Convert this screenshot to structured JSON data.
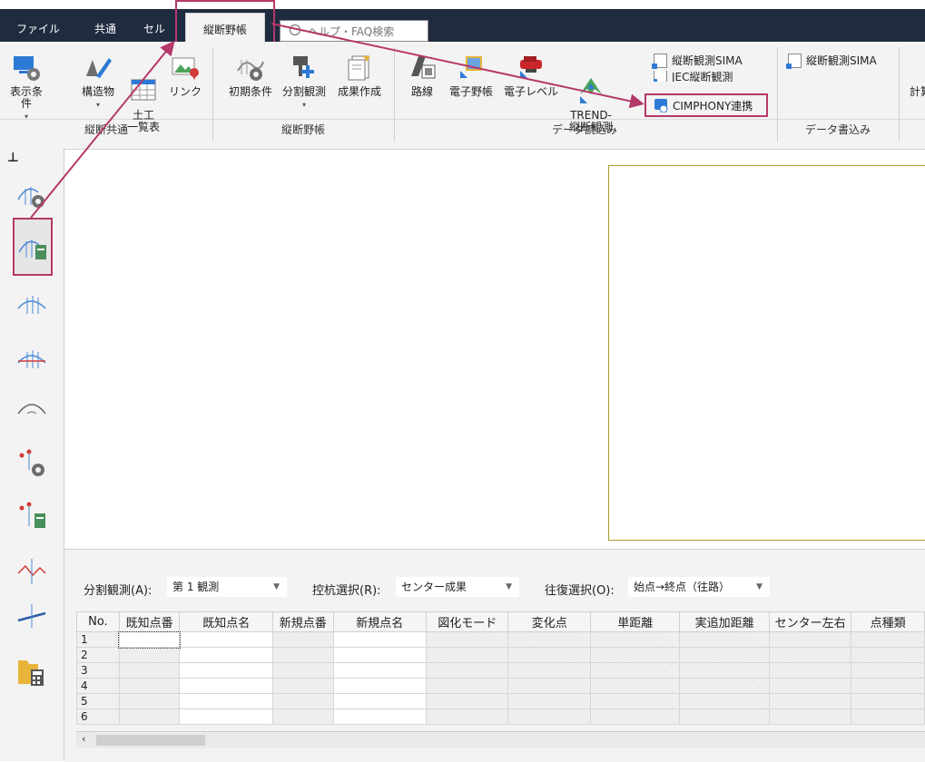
{
  "tabs": [
    "ファイル",
    "共通",
    "セル",
    "縦断野帳"
  ],
  "search_placeholder": "ヘルプ・FAQ検索",
  "ribbon": {
    "group1": {
      "label": "縦断共通",
      "buttons": [
        "表示条件",
        "構造物",
        "土工\n一覧表",
        "リンク"
      ]
    },
    "group2": {
      "label": "縦断野帳",
      "buttons": [
        "初期条件",
        "分割観測",
        "成果作成"
      ]
    },
    "group3": {
      "label": "データ読込み",
      "buttons": [
        "路線",
        "電子野帳",
        "電子レベル",
        "TREND-\n縦断観測"
      ],
      "small": [
        "縦断観測SIMA",
        "JEC縦断観測",
        "CIMPHONY連携"
      ]
    },
    "group4": {
      "label": "データ書込み",
      "small": [
        "縦断観測SIMA"
      ]
    },
    "group5": {
      "button": "計算"
    }
  },
  "panel": {
    "split_label": "分割観測(A):",
    "split_value": "第 1 観測",
    "stake_label": "控杭選択(R):",
    "stake_value": "センター成果",
    "round_label": "往復選択(O):",
    "round_value": "始点→終点（往路）"
  },
  "grid": {
    "columns": [
      "No.",
      "既知点番",
      "既知点名",
      "新規点番",
      "新規点名",
      "図化モード",
      "変化点",
      "単距離",
      "実追加距離",
      "センター左右",
      "点種類"
    ],
    "rows": [
      "1",
      "2",
      "3",
      "4",
      "5",
      "6"
    ]
  },
  "colors": {
    "highlight": "#b5386a",
    "tabbar": "#1f2b3f",
    "frame": "#a89a2a"
  }
}
